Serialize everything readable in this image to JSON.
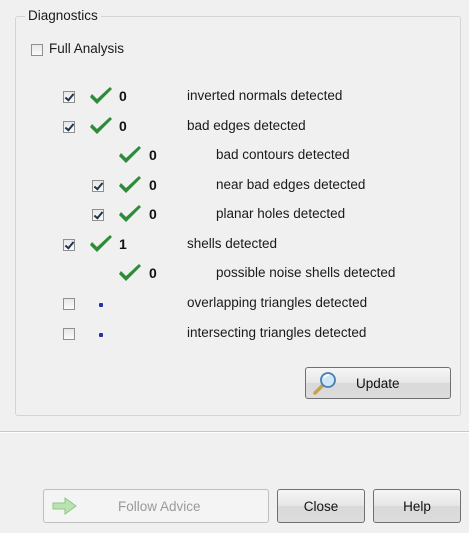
{
  "group": {
    "title": "Diagnostics"
  },
  "full_analysis": {
    "label": "Full Analysis",
    "checked": false
  },
  "rows": [
    {
      "label": "inverted normals detected",
      "count": "0",
      "checked": true,
      "status": "check-icon"
    },
    {
      "label": "bad edges detected",
      "count": "0",
      "checked": true,
      "status": "check-icon"
    },
    {
      "label": "bad contours detected",
      "count": "0",
      "status": "check-icon"
    },
    {
      "label": "near bad edges detected",
      "count": "0",
      "checked": true,
      "status": "check-icon"
    },
    {
      "label": "planar holes detected",
      "count": "0",
      "checked": true,
      "status": "check-icon"
    },
    {
      "label": "shells detected",
      "count": "1",
      "checked": true,
      "status": "check-icon"
    },
    {
      "label": "possible noise shells detected",
      "count": "0",
      "status": "check-icon"
    },
    {
      "label": "overlapping triangles detected",
      "checked": false,
      "status": "pending-dot"
    },
    {
      "label": "intersecting triangles detected",
      "checked": false,
      "status": "pending-dot"
    }
  ],
  "buttons": {
    "update": "Update",
    "follow_advice": "Follow Advice",
    "close": "Close",
    "help": "Help"
  },
  "colors": {
    "check": "#2e8b3a",
    "dot": "#2332a8"
  }
}
